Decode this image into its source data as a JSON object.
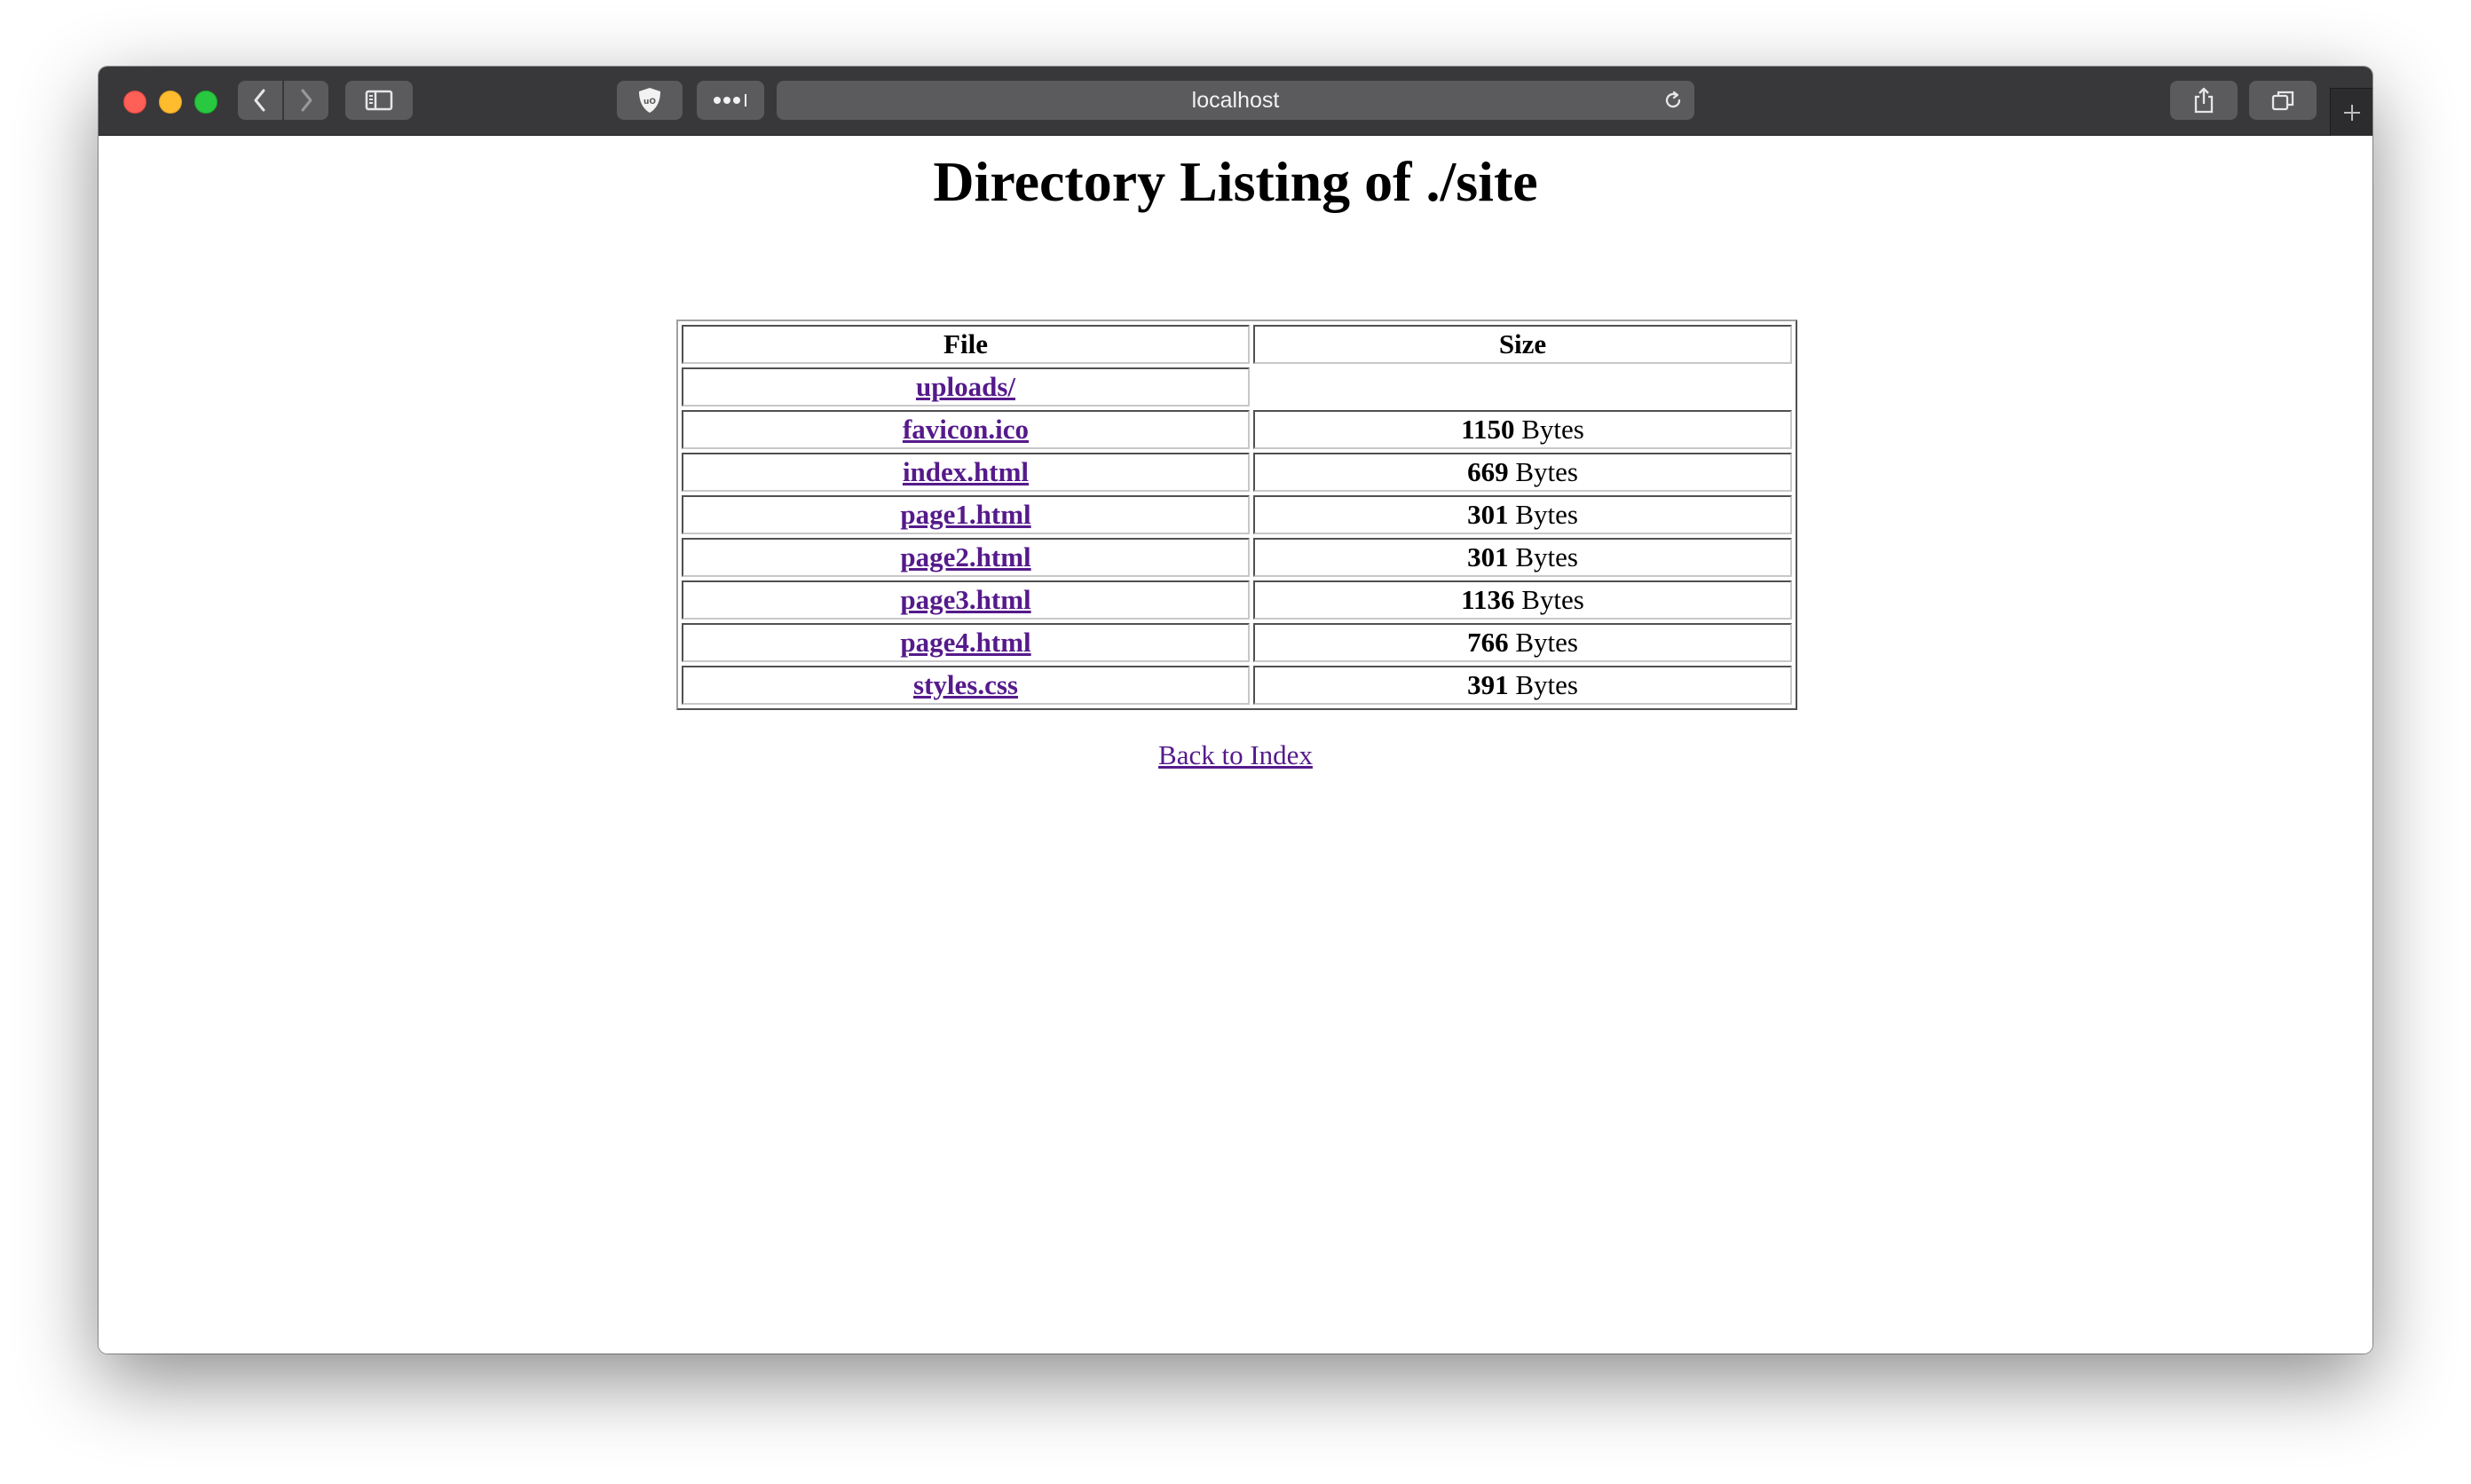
{
  "browser": {
    "address": "localhost",
    "icons": {
      "back": "chevron-left-icon",
      "forward": "chevron-right-icon",
      "sidebar": "sidebar-icon",
      "extension": "ublock-shield-icon",
      "more": "more-dots-icon",
      "reload": "reload-icon",
      "share": "share-icon",
      "tabs": "tabs-overview-icon",
      "new_tab": "plus-icon"
    }
  },
  "page": {
    "title": "Directory Listing of ./site",
    "table": {
      "headers": {
        "file": "File",
        "size": "Size"
      },
      "rows": [
        {
          "name": "uploads/",
          "size": null,
          "unit": null
        },
        {
          "name": "favicon.ico",
          "size": "1150",
          "unit": "Bytes"
        },
        {
          "name": "index.html",
          "size": "669",
          "unit": "Bytes"
        },
        {
          "name": "page1.html",
          "size": "301",
          "unit": "Bytes"
        },
        {
          "name": "page2.html",
          "size": "301",
          "unit": "Bytes"
        },
        {
          "name": "page3.html",
          "size": "1136",
          "unit": "Bytes"
        },
        {
          "name": "page4.html",
          "size": "766",
          "unit": "Bytes"
        },
        {
          "name": "styles.css",
          "size": "391",
          "unit": "Bytes"
        }
      ]
    },
    "back_link": "Back to Index"
  },
  "colors": {
    "toolbar": "#38383a",
    "link_visited": "#551a8b",
    "traffic_close": "#fe5f57",
    "traffic_minimize": "#febc2e",
    "traffic_maximize": "#28c840"
  }
}
